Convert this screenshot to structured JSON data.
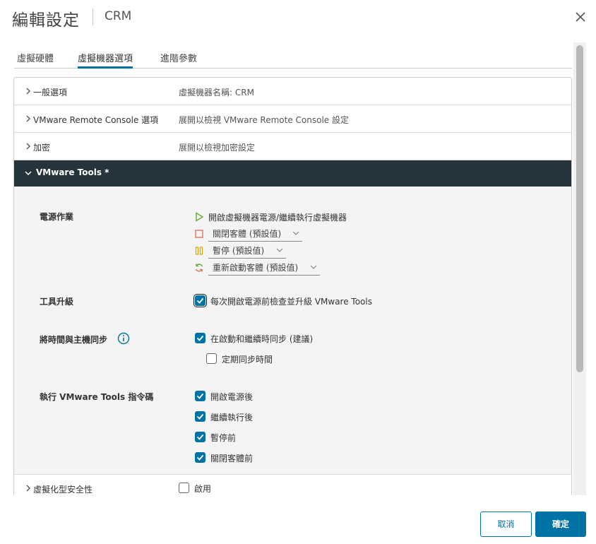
{
  "header": {
    "title": "編輯設定",
    "subtitle": "CRM"
  },
  "tabs": [
    {
      "label": "虛擬硬體",
      "active": false
    },
    {
      "label": "虛擬機器選項",
      "active": true
    },
    {
      "label": "進階參數",
      "active": false
    }
  ],
  "sections": {
    "general": {
      "label": "一般選項",
      "value": "虛擬機器名稱: CRM"
    },
    "vmrc": {
      "label": "VMware Remote Console 選項",
      "value": "展開以檢視 VMware Remote Console 設定"
    },
    "encryption": {
      "label": "加密",
      "value": "展開以檢視加密設定"
    },
    "vmware_tools": {
      "label": "VMware Tools *"
    },
    "vbs": {
      "label": "虛擬化型安全性",
      "checkbox_label": "啟用",
      "checked": false
    }
  },
  "tools": {
    "power_ops": {
      "label": "電源作業",
      "start": "開啟虛擬機器電源/繼續執行虛擬機器",
      "stop": "關閉客體 (預設值)",
      "suspend": "暫停 (預設值)",
      "reset": "重新啟動客體 (預設值)"
    },
    "upgrade": {
      "label": "工具升級",
      "checkbox_label": "每次開啟電源前檢查並升級 VMware Tools",
      "checked": true
    },
    "time_sync": {
      "label": "將時間與主機同步",
      "startup": {
        "label": "在啟動和繼續時同步 (建議)",
        "checked": true
      },
      "periodic": {
        "label": "定期同步時間",
        "checked": false
      }
    },
    "scripts": {
      "label": "執行 VMware Tools 指令碼",
      "after_power_on": {
        "label": "開啟電源後",
        "checked": true
      },
      "after_resume": {
        "label": "繼續執行後",
        "checked": true
      },
      "before_suspend": {
        "label": "暫停前",
        "checked": true
      },
      "before_shutdown": {
        "label": "關閉客體前",
        "checked": true
      }
    }
  },
  "footer": {
    "cancel_label": "取消",
    "ok_label": "確定"
  },
  "colors": {
    "accent": "#0072a3",
    "header_dark": "#25343b",
    "play_green": "#5aa220",
    "stop_red": "#e06a4a",
    "suspend_amber": "#d9a400"
  }
}
